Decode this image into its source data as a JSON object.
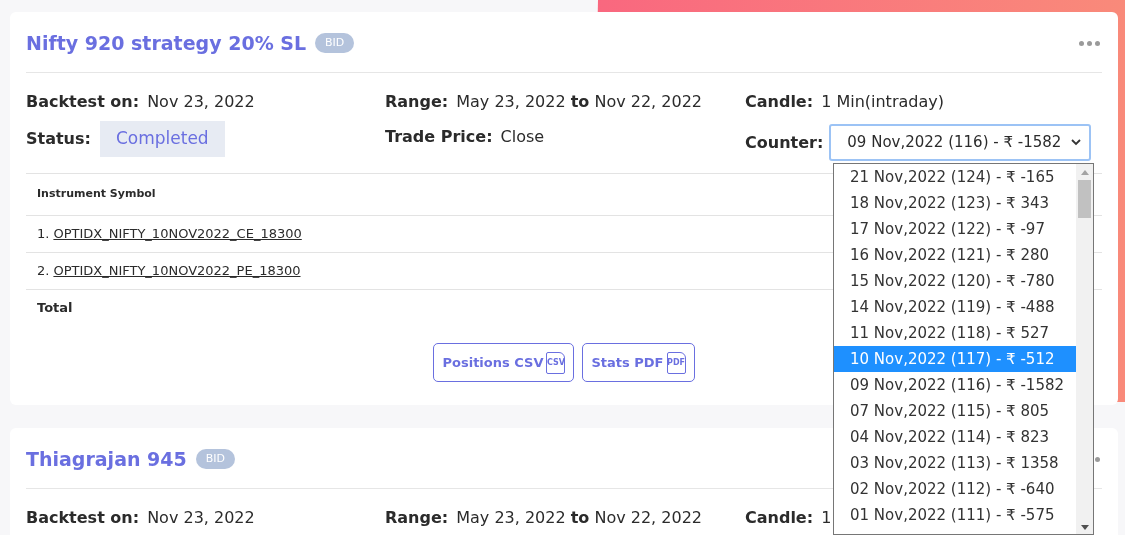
{
  "strategies": [
    {
      "title": "Nifty 920 strategy 20% SL",
      "badge": "BID",
      "backtest_label": "Backtest on:",
      "backtest_value": "Nov 23, 2022",
      "range_label": "Range:",
      "range_value": "May 23, 2022 **to** Nov 22, 2022",
      "candle_label": "Candle:",
      "candle_value": "1 Min(intraday)",
      "status_label": "Status:",
      "status_value": "Completed",
      "trade_price_label": "Trade Price:",
      "trade_price_value": "Close",
      "counter_label": "Counter:",
      "counter_value": "09 Nov,2022 (116) - ₹ -1582",
      "table": {
        "column_1": "Instrument Symbol",
        "rows": [
          {
            "index": "1.",
            "symbol": "OPTIDX_NIFTY_10NOV2022_CE_18300"
          },
          {
            "index": "2.",
            "symbol": "OPTIDX_NIFTY_10NOV2022_PE_18300"
          }
        ],
        "total_label": "Total"
      },
      "buttons": [
        {
          "label": "Positions CSV",
          "file_tag": "CSV"
        },
        {
          "label": "Stats PDF",
          "file_tag": "PDF"
        }
      ]
    },
    {
      "title": "Thiagrajan 945",
      "badge": "BID",
      "backtest_label": "Backtest on:",
      "backtest_value": "Nov 23, 2022",
      "range_label": "Range:",
      "range_value": "May 23, 2022 **to** Nov 22, 2022",
      "candle_label": "Candle:",
      "candle_value": "1"
    }
  ],
  "counter_dropdown": {
    "options": [
      {
        "label": "21 Nov,2022 (124) - ₹ -165",
        "selected": false
      },
      {
        "label": "18 Nov,2022 (123) - ₹ 343",
        "selected": false
      },
      {
        "label": "17 Nov,2022 (122) - ₹ -97",
        "selected": false
      },
      {
        "label": "16 Nov,2022 (121) - ₹ 280",
        "selected": false
      },
      {
        "label": "15 Nov,2022 (120) - ₹ -780",
        "selected": false
      },
      {
        "label": "14 Nov,2022 (119) - ₹ -488",
        "selected": false
      },
      {
        "label": "11 Nov,2022 (118) - ₹ 527",
        "selected": false
      },
      {
        "label": "10 Nov,2022 (117) - ₹ -512",
        "selected": true
      },
      {
        "label": "09 Nov,2022 (116) - ₹ -1582",
        "selected": false
      },
      {
        "label": "07 Nov,2022 (115) - ₹ 805",
        "selected": false
      },
      {
        "label": "04 Nov,2022 (114) - ₹ 823",
        "selected": false
      },
      {
        "label": "03 Nov,2022 (113) - ₹ 1358",
        "selected": false
      },
      {
        "label": "02 Nov,2022 (112) - ₹ -640",
        "selected": false
      },
      {
        "label": "01 Nov,2022 (111) - ₹ -575",
        "selected": false
      }
    ]
  }
}
